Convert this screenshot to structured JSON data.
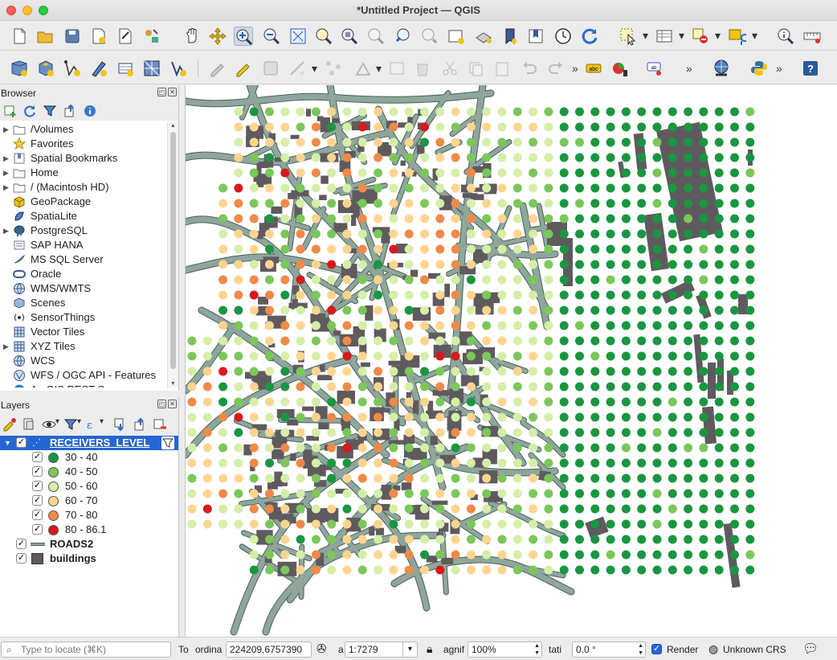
{
  "window": {
    "title": "*Untitled Project — QGIS"
  },
  "browser_panel": {
    "title": "Browser",
    "items": [
      {
        "label": "/Volumes",
        "expandable": true,
        "icon": "folder-icon"
      },
      {
        "label": "Favorites",
        "expandable": false,
        "icon": "star-icon"
      },
      {
        "label": "Spatial Bookmarks",
        "expandable": true,
        "icon": "bookmark-icon"
      },
      {
        "label": "Home",
        "expandable": true,
        "icon": "folder-icon"
      },
      {
        "label": "/ (Macintosh HD)",
        "expandable": true,
        "icon": "folder-icon"
      },
      {
        "label": "GeoPackage",
        "expandable": false,
        "icon": "geopackage-icon"
      },
      {
        "label": "SpatiaLite",
        "expandable": false,
        "icon": "spatialite-icon"
      },
      {
        "label": "PostgreSQL",
        "expandable": true,
        "icon": "postgresql-icon"
      },
      {
        "label": "SAP HANA",
        "expandable": false,
        "icon": "saphana-icon"
      },
      {
        "label": "MS SQL Server",
        "expandable": false,
        "icon": "mssql-icon"
      },
      {
        "label": "Oracle",
        "expandable": false,
        "icon": "oracle-icon"
      },
      {
        "label": "WMS/WMTS",
        "expandable": false,
        "icon": "globe-icon"
      },
      {
        "label": "Scenes",
        "expandable": false,
        "icon": "scenes-icon"
      },
      {
        "label": "SensorThings",
        "expandable": false,
        "icon": "sensor-icon"
      },
      {
        "label": "Vector Tiles",
        "expandable": false,
        "icon": "grid-icon"
      },
      {
        "label": "XYZ Tiles",
        "expandable": true,
        "icon": "grid-icon"
      },
      {
        "label": "WCS",
        "expandable": false,
        "icon": "globe-icon"
      },
      {
        "label": "WFS / OGC API - Features",
        "expandable": false,
        "icon": "wfs-icon"
      },
      {
        "label": "ArcGIS REST Servers",
        "expandable": false,
        "icon": "arcgis-icon"
      }
    ]
  },
  "layers_panel": {
    "title": "Layers",
    "layers": [
      {
        "name": "RECEIVERS_LEVEL",
        "checked": true,
        "selected": true
      },
      {
        "name": "ROADS2",
        "checked": true,
        "selected": false
      },
      {
        "name": "buildings",
        "checked": true,
        "selected": false
      }
    ],
    "classes": [
      {
        "label": "30 - 40",
        "color": "#1a9641"
      },
      {
        "label": "40 - 50",
        "color": "#7bc75a"
      },
      {
        "label": "50 - 60",
        "color": "#d5efa8"
      },
      {
        "label": "60 - 70",
        "color": "#fed590"
      },
      {
        "label": "70 - 80",
        "color": "#f08a48"
      },
      {
        "label": "80 - 86.1",
        "color": "#d7191c"
      }
    ]
  },
  "colors": {
    "road": "#8ea69b",
    "road_edge": "#4d6258",
    "building": "#5f5a5e",
    "selection": "#2466d3"
  },
  "statusbar": {
    "locate_placeholder": "Type to locate (⌘K)",
    "coordinate_label": "ordina",
    "coordinate_value": "224209,6757390",
    "scale_label": "a",
    "scale_value": "1:7279",
    "magnifier_label": "agnif",
    "magnifier_value": "100%",
    "rotation_label": "tati",
    "rotation_value": "0.0 °",
    "render_label": "Render",
    "crs_label": "Unknown CRS",
    "to_label": "To"
  }
}
